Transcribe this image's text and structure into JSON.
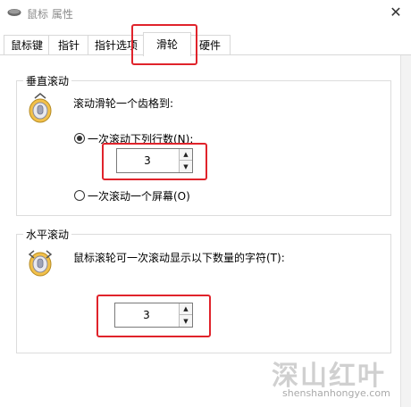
{
  "window": {
    "title": "鼠标 属性",
    "close_glyph": "✕"
  },
  "tabs": [
    {
      "label": "鼠标键"
    },
    {
      "label": "指针"
    },
    {
      "label": "指针选项"
    },
    {
      "label": "滑轮"
    },
    {
      "label": "硬件"
    }
  ],
  "active_tab": "滑轮",
  "vertical": {
    "group_title": "垂直滚动",
    "description": "滚动滑轮一个齿格到:",
    "option_lines": "一次滚动下列行数(N):",
    "lines_value": "3",
    "option_screen": "一次滚动一个屏幕(O)",
    "selected": "option_lines"
  },
  "horizontal": {
    "group_title": "水平滚动",
    "description": "鼠标滚轮可一次滚动显示以下数量的字符(T):",
    "chars_value": "3"
  },
  "spinner": {
    "up_glyph": "▲",
    "down_glyph": "▼"
  },
  "icons": {
    "app": "mouse-icon",
    "wheel": "mouse-wheel-icon"
  },
  "watermark": {
    "main": "深山红叶",
    "sub": "shenshanhongye.com"
  },
  "colors": {
    "highlight": "#e0232b",
    "border": "#dcdcdc"
  }
}
